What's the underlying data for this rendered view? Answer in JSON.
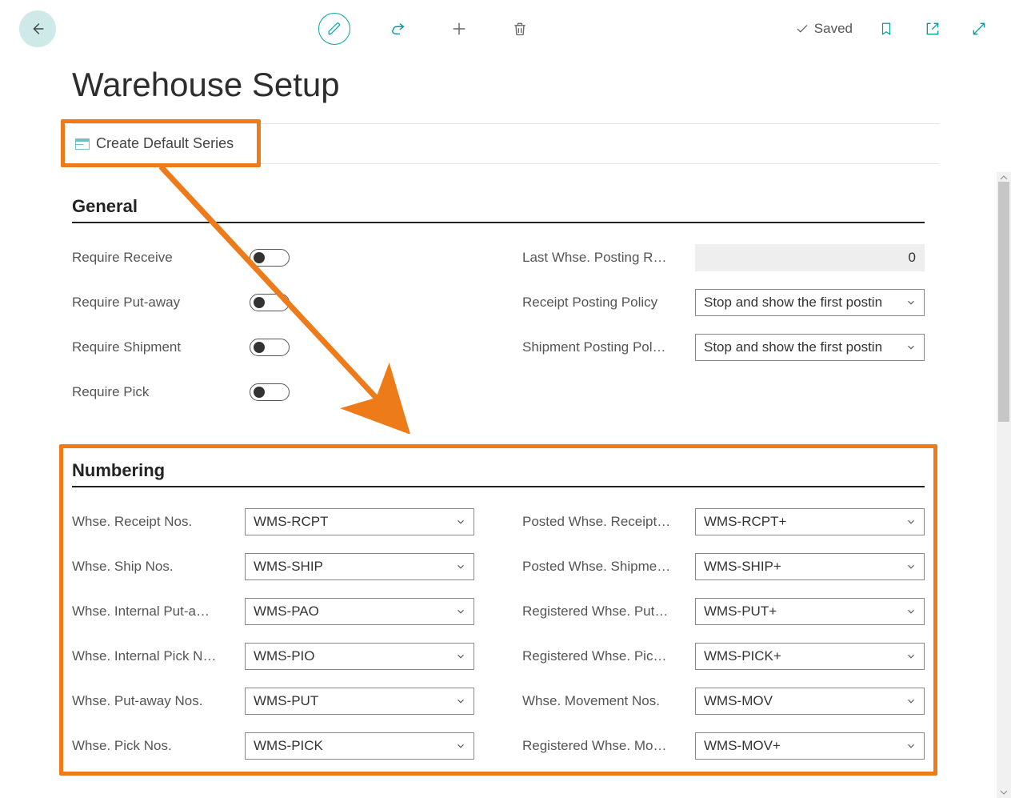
{
  "page": {
    "title": "Warehouse Setup",
    "saved_label": "Saved"
  },
  "action_bar": {
    "create_default_series": "Create Default Series"
  },
  "sections": {
    "general": {
      "title": "General",
      "require_receive": "Require Receive",
      "require_putaway": "Require Put-away",
      "require_shipment": "Require Shipment",
      "require_pick": "Require Pick",
      "last_posting_label": "Last Whse. Posting R…",
      "last_posting_value": "0",
      "receipt_policy_label": "Receipt Posting Policy",
      "receipt_policy_value": "Stop and show the first postin",
      "shipment_policy_label": "Shipment Posting Pol…",
      "shipment_policy_value": "Stop and show the first postin"
    },
    "numbering": {
      "title": "Numbering",
      "left": [
        {
          "label": "Whse. Receipt Nos.",
          "value": "WMS-RCPT"
        },
        {
          "label": "Whse. Ship Nos.",
          "value": "WMS-SHIP"
        },
        {
          "label": "Whse. Internal Put-a…",
          "value": "WMS-PAO"
        },
        {
          "label": "Whse. Internal Pick N…",
          "value": "WMS-PIO"
        },
        {
          "label": "Whse. Put-away Nos.",
          "value": "WMS-PUT"
        },
        {
          "label": "Whse. Pick Nos.",
          "value": "WMS-PICK"
        }
      ],
      "right": [
        {
          "label": "Posted Whse. Receipt…",
          "value": "WMS-RCPT+"
        },
        {
          "label": "Posted Whse. Shipme…",
          "value": "WMS-SHIP+"
        },
        {
          "label": "Registered Whse. Put…",
          "value": "WMS-PUT+"
        },
        {
          "label": "Registered Whse. Pic…",
          "value": "WMS-PICK+"
        },
        {
          "label": "Whse. Movement Nos.",
          "value": "WMS-MOV"
        },
        {
          "label": "Registered Whse. Mo…",
          "value": "WMS-MOV+"
        }
      ]
    }
  }
}
